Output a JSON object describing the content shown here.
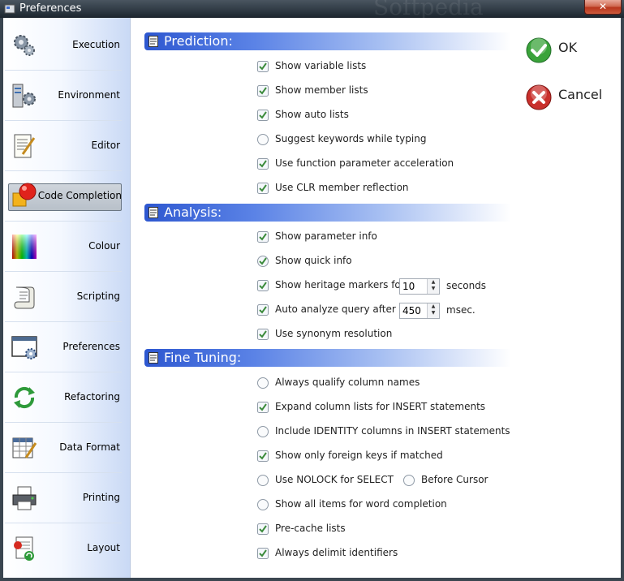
{
  "window": {
    "title": "Preferences",
    "close": "✕",
    "watermark": "Softpedia"
  },
  "sidebar": {
    "items": [
      {
        "label": "Execution",
        "icon": "gears-icon"
      },
      {
        "label": "Environment",
        "icon": "computer-gears-icon"
      },
      {
        "label": "Editor",
        "icon": "notepad-pencil-icon"
      },
      {
        "label": "Code Completion",
        "icon": "cubes-icon",
        "active": true
      },
      {
        "label": "Colour",
        "icon": "color-spectrum-icon"
      },
      {
        "label": "Scripting",
        "icon": "scroll-icon"
      },
      {
        "label": "Preferences",
        "icon": "window-gear-icon"
      },
      {
        "label": "Refactoring",
        "icon": "refresh-arrows-icon"
      },
      {
        "label": "Data Format",
        "icon": "grid-pencil-icon"
      },
      {
        "label": "Printing",
        "icon": "printer-icon"
      },
      {
        "label": "Layout",
        "icon": "document-layout-icon"
      }
    ]
  },
  "sections": {
    "prediction": {
      "title": "Prediction:",
      "options": [
        {
          "label": "Show variable lists",
          "type": "check",
          "checked": true
        },
        {
          "label": "Show member lists",
          "type": "check",
          "checked": true
        },
        {
          "label": "Show auto lists",
          "type": "check",
          "checked": true
        },
        {
          "label": "Suggest keywords while typing",
          "type": "radio",
          "checked": false
        },
        {
          "label": "Use function parameter acceleration",
          "type": "check",
          "checked": true
        },
        {
          "label": "Use CLR member reflection",
          "type": "check",
          "checked": true
        }
      ]
    },
    "analysis": {
      "title": "Analysis:",
      "options": [
        {
          "label": "Show parameter info",
          "type": "check",
          "checked": true
        },
        {
          "label": "Show quick info",
          "type": "check",
          "checked": true
        },
        {
          "label": "Show heritage markers for",
          "type": "check",
          "checked": true,
          "value": "10",
          "unit": "seconds"
        },
        {
          "label": "Auto analyze query after",
          "type": "check",
          "checked": true,
          "value": "450",
          "unit": "msec."
        },
        {
          "label": "Use synonym resolution",
          "type": "check",
          "checked": true
        }
      ]
    },
    "fine_tuning": {
      "title": "Fine Tuning:",
      "options": [
        {
          "label": "Always qualify column names",
          "type": "radio",
          "checked": false
        },
        {
          "label": "Expand column lists for INSERT statements",
          "type": "check",
          "checked": true
        },
        {
          "label": "Include IDENTITY columns in INSERT statements",
          "type": "radio",
          "checked": false
        },
        {
          "label": "Show only foreign keys if matched",
          "type": "check",
          "checked": true
        },
        {
          "label": "Use NOLOCK for SELECT",
          "type": "radio",
          "checked": false
        },
        {
          "label": "Show all items for word completion",
          "type": "radio",
          "checked": false
        },
        {
          "label": "Pre-cache lists",
          "type": "check",
          "checked": true
        },
        {
          "label": "Always delimit identifiers",
          "type": "check",
          "checked": true
        }
      ],
      "before_cursor": {
        "label": "Before Cursor",
        "type": "radio",
        "checked": false
      }
    }
  },
  "actions": {
    "ok": {
      "label": "OK",
      "icon": "green-check-icon",
      "color": "#3aa33a"
    },
    "cancel": {
      "label": "Cancel",
      "icon": "red-x-icon",
      "color": "#c9302c"
    }
  }
}
